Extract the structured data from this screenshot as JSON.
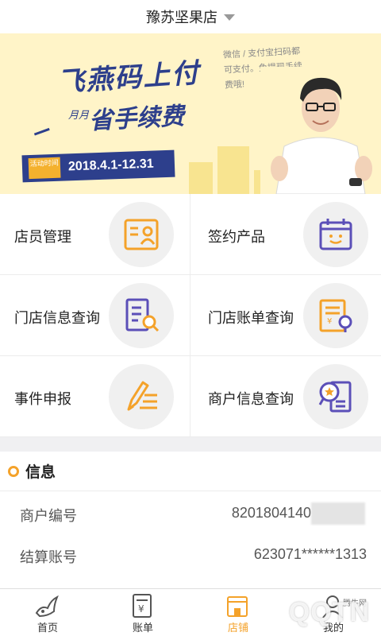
{
  "header": {
    "store_name": "豫苏坚果店"
  },
  "banner": {
    "headline": "飞燕码上付",
    "sub_prefix": "月月",
    "sub_main": "省手续费",
    "date_tag": "活动时间",
    "date": "2018.4.1-12.31",
    "blurb": "微信 / 支付宝扫码都可支付。免提现手续费哦!"
  },
  "menu": [
    {
      "label": "店员管理",
      "icon": "staff-card-icon"
    },
    {
      "label": "签约产品",
      "icon": "calendar-smile-icon"
    },
    {
      "label": "门店信息查询",
      "icon": "document-search-icon"
    },
    {
      "label": "门店账单查询",
      "icon": "bill-stamp-icon"
    },
    {
      "label": "事件申报",
      "icon": "pencil-report-icon"
    },
    {
      "label": "商户信息查询",
      "icon": "merchant-search-icon"
    }
  ],
  "info": {
    "title": "信息",
    "rows": [
      {
        "key": "商户编号",
        "value": "8201804140"
      },
      {
        "key": "结算账号",
        "value": "623071******1313"
      }
    ]
  },
  "tabs": [
    {
      "label": "首页",
      "icon": "home-icon"
    },
    {
      "label": "账单",
      "icon": "bill-icon"
    },
    {
      "label": "店铺",
      "icon": "store-icon"
    },
    {
      "label": "我的",
      "icon": "user-icon"
    }
  ],
  "watermark": {
    "text": "QQTN",
    "small": "腾牛网"
  },
  "colors": {
    "accent": "#f4a22a",
    "icon_blue": "#5b4fb8",
    "banner_navy": "#2d3f8c"
  }
}
